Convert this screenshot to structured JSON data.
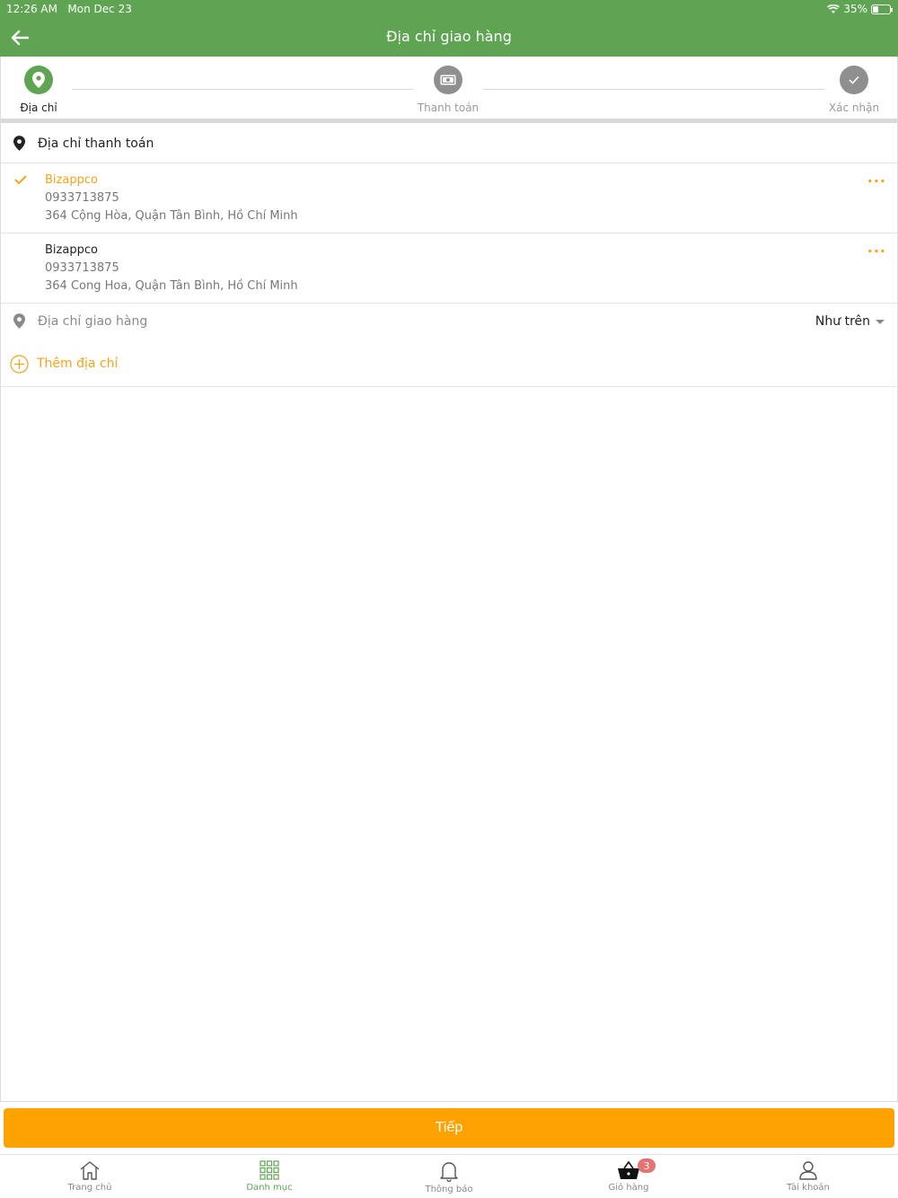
{
  "status_bar": {
    "time": "12:26 AM",
    "date": "Mon Dec 23",
    "battery": "35%"
  },
  "nav": {
    "title": "Địa chỉ giao hàng",
    "back_icon": "arrow-left-icon"
  },
  "colors": {
    "primary_green": "#5fa452",
    "accent_orange": "#fda200",
    "badge_red": "#e57373"
  },
  "steps": [
    {
      "label": "Địa chỉ",
      "icon": "location-pin-icon",
      "state": "active"
    },
    {
      "label": "Thanh toán",
      "icon": "cash-icon",
      "state": "pending"
    },
    {
      "label": "Xác nhận",
      "icon": "check-icon",
      "state": "pending"
    }
  ],
  "billing": {
    "label": "Địa chỉ thanh toán"
  },
  "addresses": [
    {
      "name": "Bizappco",
      "phone": "0933713875",
      "address": "364 Cộng Hòa, Quận Tân Bình, Hồ Chí Minh",
      "selected": true,
      "more": "···"
    },
    {
      "name": "Bizappco",
      "phone": "0933713875",
      "address": "364 Cong Hoa, Quận Tân Bình, Hồ Chí Minh",
      "selected": false,
      "more": "···"
    }
  ],
  "shipping": {
    "label": "Địa chỉ giao hàng",
    "selected_option": "Như trên"
  },
  "add_address": {
    "label": "Thêm địa chỉ"
  },
  "next_button": {
    "label": "Tiếp"
  },
  "tabs": [
    {
      "label": "Trang chủ",
      "icon": "home-icon",
      "active": false
    },
    {
      "label": "Danh mục",
      "icon": "grid-icon",
      "active": true
    },
    {
      "label": "Thông báo",
      "icon": "bell-icon",
      "active": false
    },
    {
      "label": "Giỏ hàng",
      "icon": "basket-icon",
      "active": false,
      "badge": "3"
    },
    {
      "label": "Tài khoản",
      "icon": "user-icon",
      "active": false
    }
  ]
}
